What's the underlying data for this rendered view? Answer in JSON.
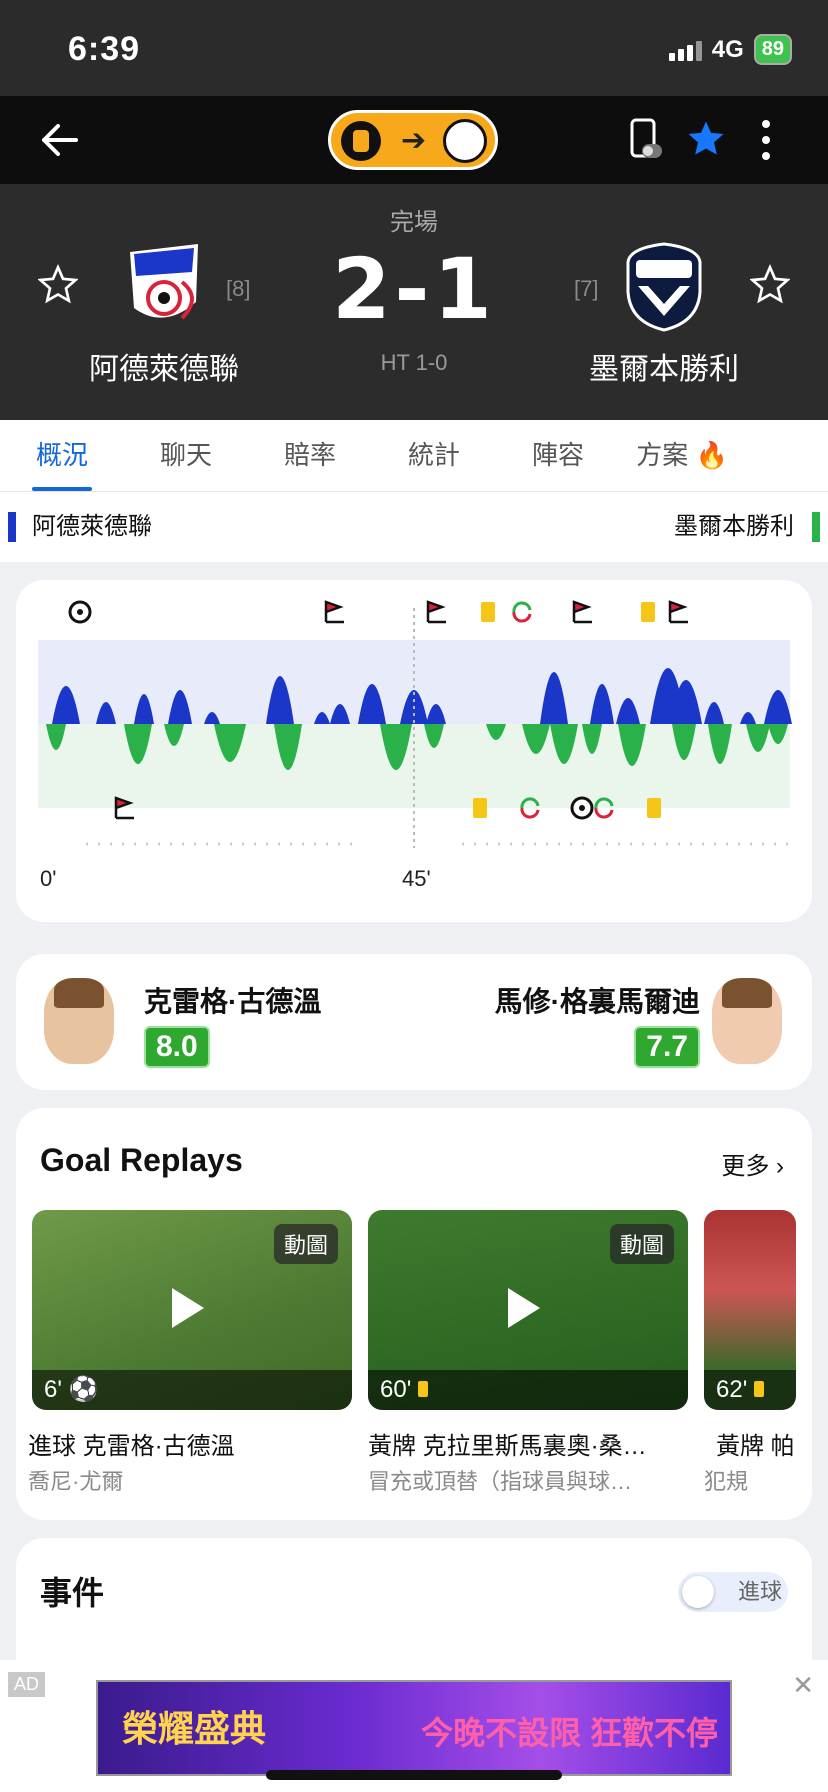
{
  "status_bar": {
    "time": "6:39",
    "network": "4G",
    "battery": "89"
  },
  "match": {
    "status": "完場",
    "score": "2-1",
    "halftime": "HT 1-0",
    "home": {
      "name": "阿德萊德聯",
      "rank": "[8]",
      "color": "#1b37c9"
    },
    "away": {
      "name": "墨爾本勝利",
      "rank": "[7]",
      "color": "#2bb14a"
    }
  },
  "tabs": [
    {
      "label": "概況",
      "active": true
    },
    {
      "label": "聊天"
    },
    {
      "label": "賠率"
    },
    {
      "label": "統計"
    },
    {
      "label": "陣容"
    },
    {
      "label": "方案"
    }
  ],
  "momentum": {
    "start_label": "0'",
    "half_label": "45'",
    "home_events": [
      "goal",
      "corner",
      "corner",
      "yellow-card",
      "substitution",
      "corner",
      "yellow-card",
      "corner"
    ],
    "away_events": [
      "corner",
      "yellow-card",
      "substitution",
      "goal",
      "substitution",
      "yellow-card"
    ]
  },
  "ratings": {
    "home_player": {
      "name": "克雷格·古德溫",
      "rating": "8.0"
    },
    "away_player": {
      "name": "馬修·格裏馬爾迪",
      "rating": "7.7"
    }
  },
  "replays": {
    "title": "Goal Replays",
    "more": "更多",
    "items": [
      {
        "badge": "動圖",
        "minute": "6'",
        "icon": "goal-icon",
        "title": "進球 克雷格·古德溫",
        "subtitle": "喬尼·尤爾"
      },
      {
        "badge": "動圖",
        "minute": "60'",
        "icon": "yellow-card-icon",
        "title": "黃牌 克拉里斯馬裏奧·桑…",
        "subtitle": "冒充或頂替（指球員與球…"
      },
      {
        "badge": "",
        "minute": "62'",
        "icon": "yellow-card-icon",
        "title": "黃牌 帕",
        "subtitle": "犯規"
      }
    ]
  },
  "events": {
    "title": "事件",
    "toggle_label": "進球"
  },
  "ad": {
    "tag": "AD",
    "left_text": "榮耀盛典",
    "right_text": "今晚不設限 狂歡不停"
  }
}
